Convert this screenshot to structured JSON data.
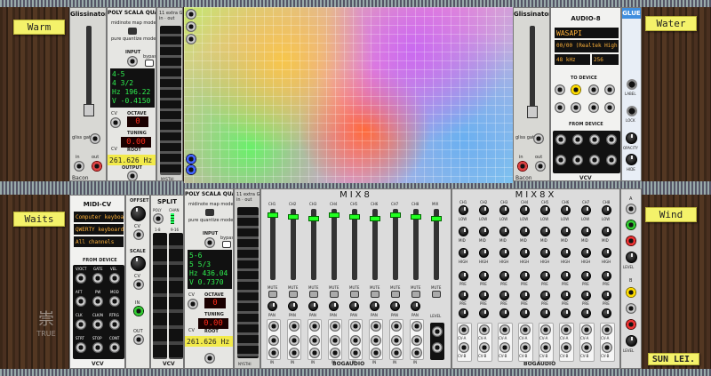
{
  "notes": {
    "top_left": "Warm",
    "top_right": "Water",
    "mid_left": "Waits",
    "mid_right": "Wind",
    "bottom_right": "SUN LEI."
  },
  "glissinator": {
    "title": "Glissinator",
    "gate_label": "gliss gate",
    "in_label": "in",
    "out_label": "out",
    "brand": "Bacon"
  },
  "psq1": {
    "title": "POLY SCALA QUANTIZER",
    "map_mode": "midinote map mode",
    "quantize_mode": "pure quantize mode",
    "input_label": "INPUT",
    "bypass_label": "bypass",
    "cv_label": "CV",
    "octave_label": "OCTAVE",
    "octave_value": "0",
    "tuning_label": "TUNING",
    "tuning_value": "0.00",
    "root_label": "ROOT",
    "root_value": "261.626 Hz",
    "output_label": "OUTPUT",
    "screen": [
      "4-5",
      "4 3/2",
      "Hz 196.22",
      "V -0.4150"
    ],
    "side_title": "11 extra G in · out",
    "brand": "NYSTHI"
  },
  "psq2": {
    "title": "POLY SCALA QUANTIZER",
    "map_mode": "midinote map mode",
    "quantize_mode": "pure quantize mode",
    "input_label": "INPUT",
    "bypass_label": "bypass",
    "cv_label": "CV",
    "octave_label": "OCTAVE",
    "octave_value": "0",
    "tuning_label": "TUNING",
    "tuning_value": "0.00",
    "root_label": "ROOT",
    "root_value": "261.626 Hz",
    "screen": [
      "5-6",
      "5 5/3",
      "Hz 436.04",
      "V 0.7370"
    ],
    "side_title": "11 extra G in · out",
    "brand": "NYSTHI"
  },
  "audio8": {
    "title": "AUDIO-8",
    "driver": "WASAPI",
    "device": "00/00 (Realtek High D",
    "rate": "48 kHz",
    "block": "256",
    "to_device": "TO DEVICE",
    "from_device": "FROM DEVICE",
    "brand": "VCV",
    "to_nums": [
      "1",
      "2",
      "3",
      "4",
      "5",
      "6",
      "7",
      "8"
    ],
    "from_nums": [
      "1",
      "2",
      "3",
      "4",
      "5",
      "6",
      "7",
      "8"
    ]
  },
  "glue": {
    "title": "GLUE",
    "label_lbl": "LABEL",
    "lock_lbl": "LOCK",
    "opacity_lbl": "OPACITY",
    "hide_lbl": "HIDE"
  },
  "midicv": {
    "title": "MIDI-CV",
    "device": "Computer keyboard",
    "keyboard": "QWERTY keyboard",
    "channels": "All channels",
    "from_device": "FROM DEVICE",
    "brand": "VCV",
    "ports": [
      "V/OCT",
      "GATE",
      "VEL",
      "AFT",
      "PW",
      "MOD",
      "CLK",
      "CLK/N",
      "RTRG",
      "STRT",
      "STOP",
      "CONT"
    ]
  },
  "offset": {
    "title": "OFFSET",
    "cv_lbl": "CV",
    "scale_lbl": "SCALE",
    "in_lbl": "IN",
    "out_lbl": "OUT"
  },
  "split": {
    "title": "SPLIT",
    "poly": "POLY",
    "chan": "CHAN",
    "rows": [
      "1-8",
      "9-16"
    ],
    "brand": "VCV"
  },
  "mix8": {
    "title": "MIX8",
    "brand": "BOGAUDIO",
    "channels": [
      "CH1",
      "CH2",
      "CH3",
      "CH4",
      "CH5",
      "CH6",
      "CH7",
      "CH8"
    ],
    "mix_lbl": "MIX",
    "mute_lbl": "MUTE",
    "pan_lbl": "PAN",
    "level_lbl": "LEVEL",
    "in_lbl": "IN"
  },
  "mix8x": {
    "title": "MIX8X",
    "brand": "BOGAUDIO",
    "channels": [
      "CH1",
      "CH2",
      "CH3",
      "CH4",
      "CH5",
      "CH6",
      "CH7",
      "CH8"
    ],
    "low_lbl": "LOW",
    "mid_lbl": "MID",
    "high_lbl": "HIGH",
    "pre_lbl": "PRE",
    "a_lbl": "A",
    "b_lbl": "B",
    "cva": "CV-A",
    "cvb": "CV-B",
    "level_lbl": "LEVEL"
  },
  "watermark": {
    "line1": "崇",
    "line2": "TRUE"
  }
}
